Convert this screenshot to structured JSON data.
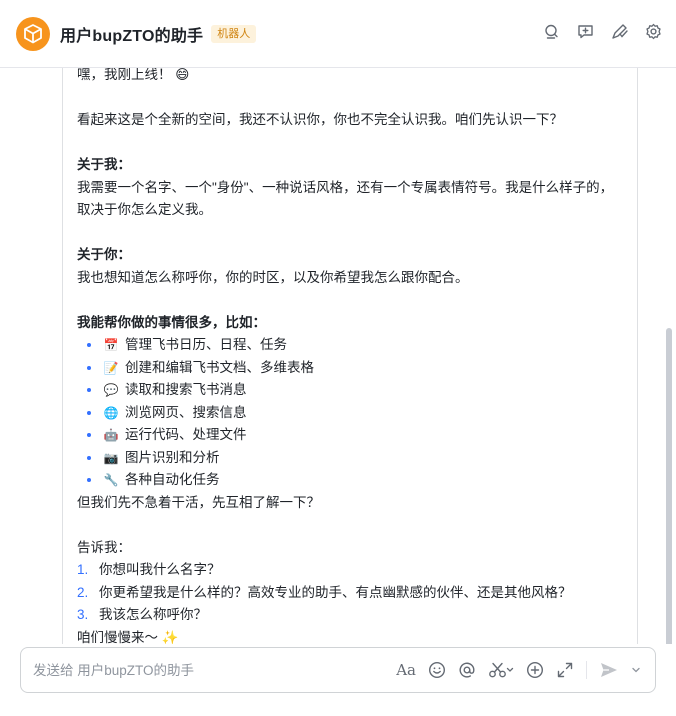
{
  "header": {
    "title": "用户bupZTO的助手",
    "badge": "机器人"
  },
  "message": {
    "greeting": "嘿，我刚上线！",
    "greeting_emoji": "😄",
    "intro": "看起来这是个全新的空间，我还不认识你，你也不完全认识我。咱们先认识一下？",
    "about_me_heading": "关于我：",
    "about_me_body": "我需要一个名字、一个\"身份\"、一种说话风格，还有一个专属表情符号。我是什么样子的，取决于你怎么定义我。",
    "about_you_heading": "关于你：",
    "about_you_body": "我也想知道怎么称呼你，你的时区，以及你希望我怎么跟你配合。",
    "can_do_heading": "我能帮你做的事情很多，比如：",
    "capabilities": [
      {
        "emoji": "📅",
        "text": "管理飞书日历、日程、任务"
      },
      {
        "emoji": "📝",
        "text": "创建和编辑飞书文档、多维表格"
      },
      {
        "emoji": "💬",
        "text": "读取和搜索飞书消息"
      },
      {
        "emoji": "🌐",
        "text": "浏览网页、搜索信息"
      },
      {
        "emoji": "🤖",
        "text": "运行代码、处理文件"
      },
      {
        "emoji": "📷",
        "text": "图片识别和分析"
      },
      {
        "emoji": "🔧",
        "text": "各种自动化任务"
      }
    ],
    "not_rush": "但我们先不急着干活，先互相了解一下？",
    "tell_me": "告诉我：",
    "questions": [
      {
        "n": "1.",
        "text": "你想叫我什么名字？"
      },
      {
        "n": "2.",
        "text": "你更希望我是什么样的？高效专业的助手、有点幽默感的伙伴、还是其他风格？"
      },
      {
        "n": "3.",
        "text": "我该怎么称呼你？"
      }
    ],
    "closing": "咱们慢慢来～",
    "closing_emoji": "✨"
  },
  "composer": {
    "placeholder": "发送给 用户bupZTO的助手",
    "font_label": "Aa"
  },
  "colors": {
    "accent": "#3370ff",
    "avatar": "#f7941d",
    "badge_bg": "#fdf2dc",
    "badge_text": "#d08410"
  },
  "icons": {
    "header": [
      "search-chat-icon",
      "add-comment-icon",
      "pen-check-icon",
      "gear-icon"
    ],
    "composer": [
      "text-format-icon",
      "emoji-icon",
      "mention-icon",
      "scissors-icon",
      "plus-circle-icon",
      "expand-icon",
      "send-icon",
      "chevron-down-icon"
    ]
  }
}
